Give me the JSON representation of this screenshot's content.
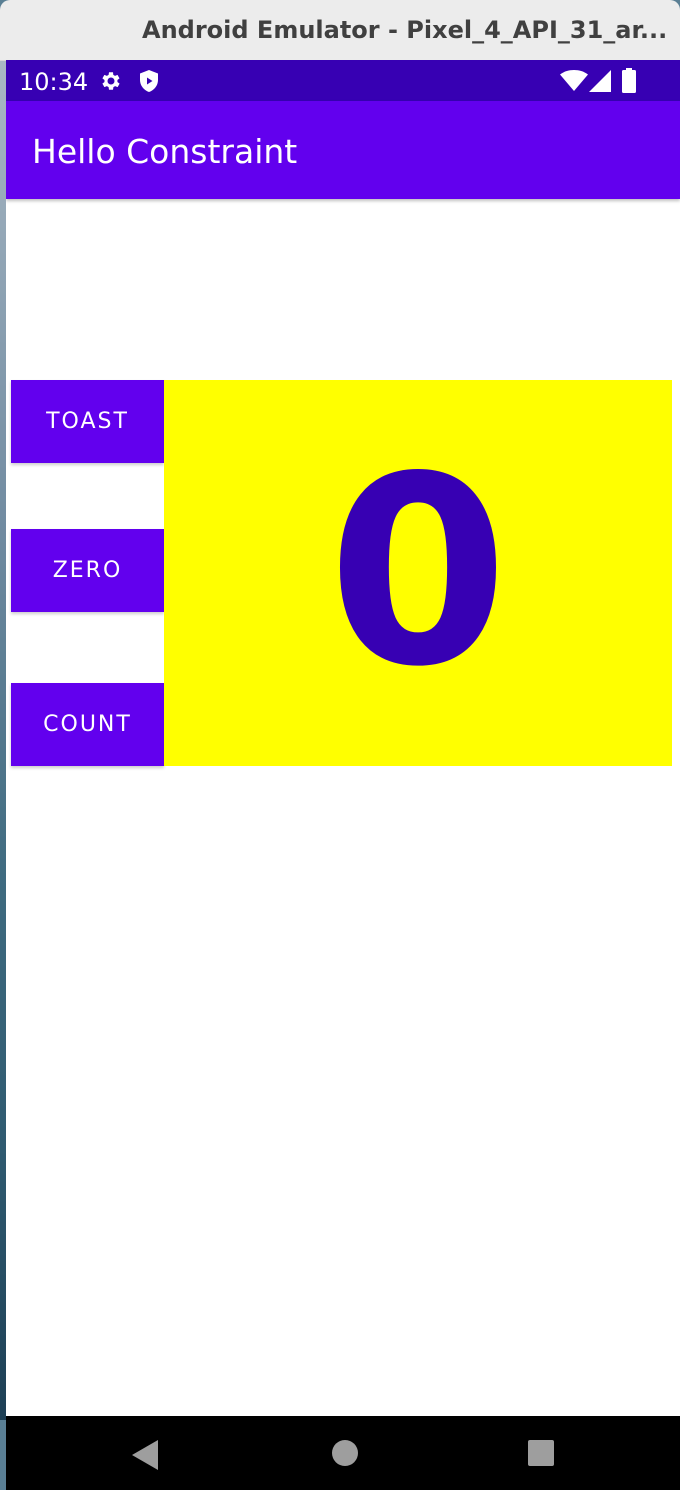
{
  "window": {
    "title": "Android Emulator - Pixel_4_API_31_ar..."
  },
  "status_bar": {
    "time": "10:34",
    "icons": [
      "gear-icon",
      "shield-icon",
      "wifi-icon",
      "signal-icon",
      "battery-icon"
    ],
    "color": "#3700b3"
  },
  "app_bar": {
    "title": "Hello Constraint",
    "color": "#6200ee"
  },
  "buttons": {
    "toast": "TOAST",
    "zero": "ZERO",
    "count": "COUNT",
    "color": "#6200ee"
  },
  "show_count": {
    "value": "0",
    "background": "#ffff00",
    "text_color": "#3700b3"
  },
  "nav_bar": {
    "icons": [
      "back-icon",
      "home-icon",
      "recents-icon"
    ]
  }
}
